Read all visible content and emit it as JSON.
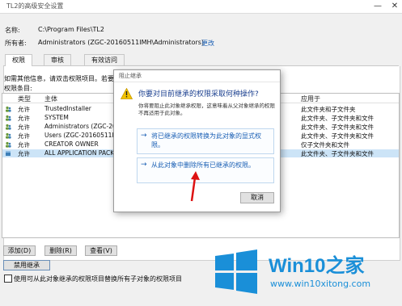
{
  "window": {
    "title": "TL2的高级安全设置",
    "minimize_icon": "minimize-icon",
    "close_icon": "close-icon"
  },
  "name_label": "名称:",
  "name_value": "C:\\Program Files\\TL2",
  "owner_label": "所有者:",
  "owner_value": "Administrators (ZGC-20160511IMH\\Administrators)",
  "owner_change": "更改",
  "tabs": [
    "权限",
    "审核",
    "有效访问"
  ],
  "info_text": "如需其他信息，请双击权限项目。若要修改",
  "entries_label": "权限条目:",
  "table": {
    "headers": [
      "类型",
      "主体",
      "应用于"
    ],
    "rows": [
      {
        "type": "允许",
        "principal": "TrustedInstaller",
        "applies": "此文件夹和子文件夹"
      },
      {
        "type": "允许",
        "principal": "SYSTEM",
        "applies": "此文件夹、子文件夹和文件"
      },
      {
        "type": "允许",
        "principal": "Administrators (ZGC-2016",
        "applies": "此文件夹、子文件夹和文件"
      },
      {
        "type": "允许",
        "principal": "Users (ZGC-20160511IMH",
        "applies": "此文件夹、子文件夹和文件"
      },
      {
        "type": "允许",
        "principal": "CREATOR OWNER",
        "applies": "仅子文件夹和文件"
      },
      {
        "type": "允许",
        "principal": "ALL APPLICATION PACKAG",
        "applies": "此文件夹、子文件夹和文件"
      }
    ]
  },
  "buttons": {
    "add": "添加(D)",
    "remove": "删除(R)",
    "view": "查看(V)",
    "disable_inheritance": "禁用继承"
  },
  "replace_checkbox": "使用可从此对象继承的权限项目替换所有子对象的权限项目",
  "dialog": {
    "title": "阻止继承",
    "question": "你要对目前继承的权限采取何种操作?",
    "description": "你将要阻止此对象继承权限，这意味着从父对象继承的权限不再适用于此对象。",
    "option1": "将已继承的权限转换为此对象的显式权限。",
    "option2": "从此对象中删除所有已继承的权限。",
    "cancel": "取消",
    "warning_icon": "warning-icon",
    "arrow_icon": "arrow-right-icon"
  },
  "watermark": {
    "brand": "Win10",
    "suffix": "之家",
    "url": "www.win10xitong.com",
    "color": "#1a8fd8"
  }
}
